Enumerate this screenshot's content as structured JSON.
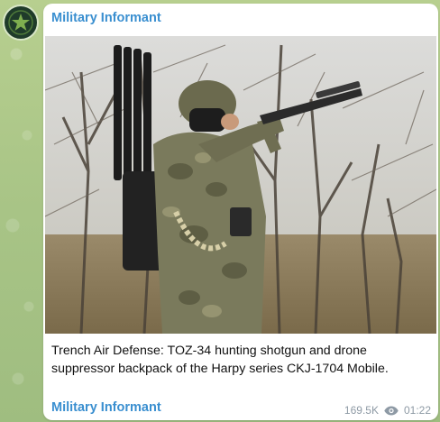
{
  "channel": {
    "name": "Military Informant",
    "avatar_icon": "military-informant-logo"
  },
  "post": {
    "caption": "Trench Air Defense: TOZ-34 hunting shotgun and drone suppressor backpack of the Harpy series CKJ-1704 Mobile.",
    "author": "Military Informant",
    "views": "169.5K",
    "time": "01:22",
    "views_icon": "eye-icon"
  },
  "colors": {
    "accent": "#3a8fd0",
    "background": "#a9c68a",
    "meta": "#8e9aa5"
  }
}
